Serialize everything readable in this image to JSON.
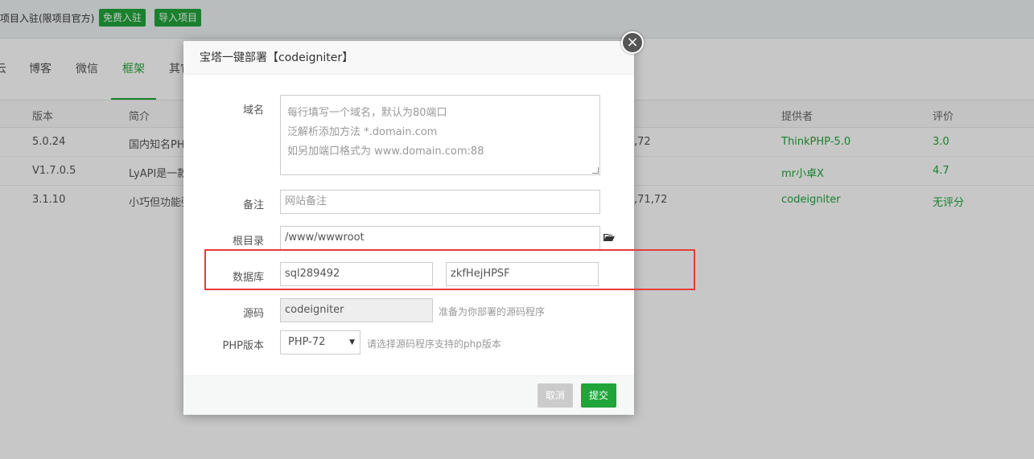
{
  "topbar": {
    "notice": "项目入驻(限项目官方)",
    "free_join": "免费入驻",
    "import_project": "导入项目"
  },
  "tabs": [
    {
      "label": "云"
    },
    {
      "label": "博客"
    },
    {
      "label": "微信"
    },
    {
      "label": "框架",
      "active": true
    },
    {
      "label": "其它"
    }
  ],
  "table": {
    "headers": [
      "版本",
      "简介",
      "提供者",
      "评价"
    ],
    "rows": [
      {
        "version": "5.0.24",
        "intro": "国内知名PHP",
        "php": ",72",
        "provider": "ThinkPHP-5.0",
        "rating": "3.0"
      },
      {
        "version": "V1.7.0.5",
        "intro": "LyAPI是一款",
        "php": "",
        "provider": "mr小卓X",
        "rating": "4.7"
      },
      {
        "version": "3.1.10",
        "intro": "小巧但功能强",
        "php": ",71,72",
        "provider": "codeigniter",
        "rating": "无评分"
      }
    ]
  },
  "modal": {
    "title": "宝塔一键部署【codeigniter】",
    "close_icon": "close-icon",
    "domain": {
      "label": "域名",
      "placeholder_lines": [
        "每行填写一个域名，默认为80端口",
        "泛解析添加方法 *.domain.com",
        "如另加端口格式为 www.domain.com:88"
      ]
    },
    "remark": {
      "label": "备注",
      "placeholder": "网站备注"
    },
    "root": {
      "label": "根目录",
      "value": "/www/wwwroot",
      "icon": "folder-icon"
    },
    "database": {
      "label": "数据库",
      "name": "sql289492",
      "password": "zkfHejHPSF"
    },
    "source": {
      "label": "源码",
      "value": "codeigniter",
      "hint": "准备为你部署的源码程序"
    },
    "php": {
      "label": "PHP版本",
      "selected": "PHP-72",
      "hint": "请选择源码程序支持的php版本"
    },
    "cancel": "取消",
    "submit": "提交"
  },
  "colors": {
    "accent": "#20a53a",
    "highlight": "#e63b3b"
  }
}
